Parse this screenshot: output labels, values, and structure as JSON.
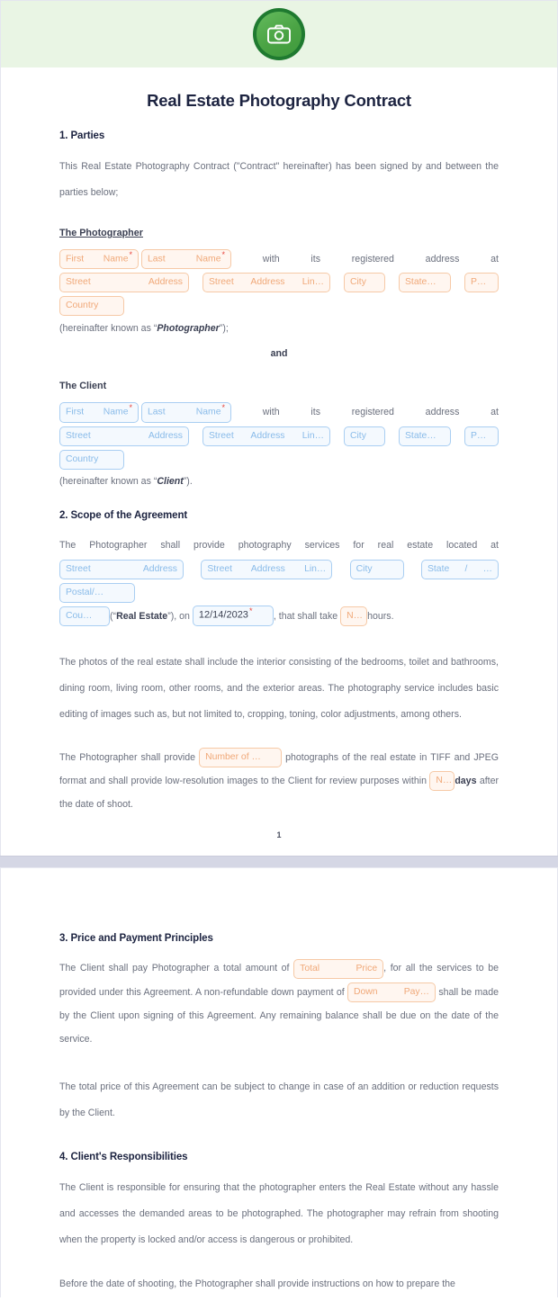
{
  "document": {
    "title": "Real Estate Photography Contract",
    "logo_icon": "camera-icon",
    "page_number": "1"
  },
  "colors": {
    "header_band": "#e9f5e4",
    "logo_ring": "#1f7a30",
    "logo_fill": "#4aa344",
    "title": "#1c2340",
    "body_text": "#6a6f7d",
    "field_orange_border": "#f6c9a6",
    "field_orange_text": "#f0a878",
    "field_blue_border": "#a9cef2",
    "field_blue_text": "#89bbe9",
    "required_asterisk": "#e8453c",
    "page_break": "#d5d7e5"
  },
  "section1": {
    "heading": "1. Parties",
    "intro": "This Real Estate Photography Contract (\"Contract\" hereinafter) has been signed by and between the parties below;",
    "photographer": {
      "heading": "The Photographer",
      "fields": {
        "first_name": "First Name",
        "last_name": "Last Name",
        "street_address": "Street Address",
        "street_address_line2": "Street Address Lin…",
        "city": "City",
        "state": "State…",
        "postal": "P…",
        "country": "Country"
      },
      "text_with": "with",
      "text_its": "its",
      "text_registered": "registered",
      "text_address": "address",
      "text_at": "at",
      "hereinafter_pre": "(hereinafter known as “",
      "hereinafter_term": "Photographer",
      "hereinafter_post": "”);"
    },
    "and_label": "and",
    "client": {
      "heading": "The Client",
      "fields": {
        "first_name": "First Name",
        "last_name": "Last Name",
        "street_address": "Street Address",
        "street_address_line2": "Street Address Lin…",
        "city": "City",
        "state": "State…",
        "postal": "P…",
        "country": "Country"
      },
      "text_with": "with",
      "text_its": "its",
      "text_registered": "registered",
      "text_address": "address",
      "text_at": "at",
      "hereinafter_pre": "(hereinafter known as “",
      "hereinafter_term": "Client",
      "hereinafter_post": "”)."
    }
  },
  "section2": {
    "heading": "2. Scope of the Agreement",
    "lead_text": "The Photographer shall provide photography services for real estate located at",
    "fields": {
      "street_address": "Street Address",
      "street_address_line2": "Street Address Lin…",
      "city": "City",
      "state": "State / …",
      "postal": "Postal/…",
      "country": "Cou…",
      "date": "12/14/2023",
      "hours": "N…"
    },
    "after_country_pre": "(“",
    "real_estate_term": "Real Estate",
    "after_country_post": "”), on",
    "after_date": ", that shall take",
    "after_hours": "hours.",
    "paragraph_photos": "The photos of the real estate shall include the interior consisting of the bedrooms, toilet and bathrooms, dining room, living room, other rooms, and the exterior areas. The photography service includes basic editing of images such as, but not limited to, cropping, toning, color adjustments, among others.",
    "delivery": {
      "pre": "The Photographer shall provide",
      "number_field": "Number of …",
      "mid": "photographs of the real estate in TIFF and JPEG format and shall provide low-resolution images to the Client for review purposes within",
      "days_field": "N…",
      "days_bold": "days",
      "post": "after the date of shoot."
    }
  },
  "section3": {
    "heading": "3. Price and Payment Principles",
    "pre_total": "The Client shall pay Photographer a total amount of",
    "total_price_field": "Total Price",
    "mid_text": ", for all the services to be provided under this Agreement. A non-refundable down payment of",
    "down_payment_field": "Down Pay…",
    "post_text": "shall be made by the Client upon signing of this Agreement. Any remaining balance shall be due on the date of the service.",
    "paragraph_change": "The total price of this Agreement can be subject to change in case of an addition or reduction requests by the Client."
  },
  "section4": {
    "heading": "4. Client's Responsibilities",
    "paragraph_1": "The Client is responsible for ensuring that the photographer enters the Real Estate without any hassle and accesses the demanded areas to be photographed. The photographer may refrain from shooting when the property is locked and/or access is dangerous or prohibited.",
    "paragraph_2": "Before the date of shooting, the Photographer shall provide instructions on how to prepare the"
  }
}
